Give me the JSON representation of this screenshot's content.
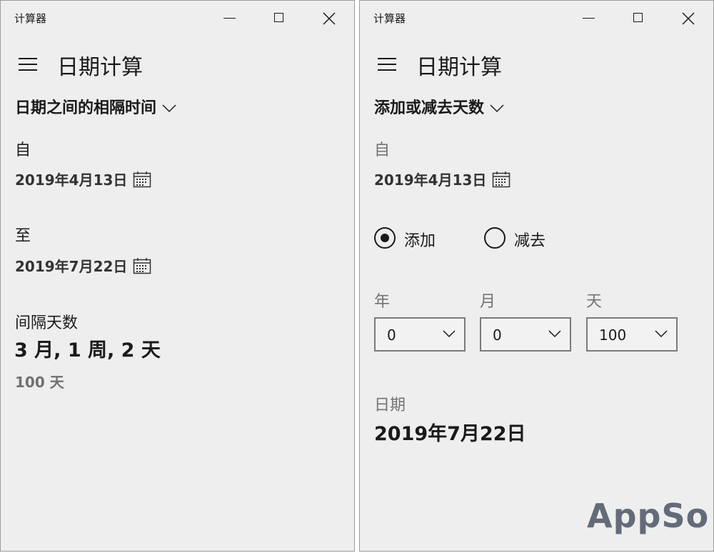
{
  "app_title": "计算器",
  "mode_title": "日期计算",
  "left": {
    "mode": "日期之间的相隔时间",
    "from_label": "自",
    "from_date": "2019年4月13日",
    "to_label": "至",
    "to_date": "2019年7月22日",
    "diff_label": "间隔天数",
    "diff_result": "3 月, 1 周, 2 天",
    "diff_days": "100 天"
  },
  "right": {
    "mode": "添加或减去天数",
    "from_label": "自",
    "from_date": "2019年4月13日",
    "radio_add": "添加",
    "radio_subtract": "减去",
    "selected_operation": "添加",
    "year_label": "年",
    "month_label": "月",
    "day_label": "天",
    "years": "0",
    "months": "0",
    "days": "100",
    "result_label": "日期",
    "result_date": "2019年7月22日"
  },
  "watermark": "AppSo",
  "colors": {
    "window_bg": "#eeeeee",
    "text": "#1a1a1a",
    "muted_text": "#737373",
    "combo_border": "#7a7a7a",
    "watermark": "#646b78"
  },
  "icons": [
    "minimize-icon",
    "maximize-icon",
    "close-icon",
    "hamburger-menu-icon",
    "chevron-down-icon",
    "calendar-icon",
    "radio-selected-icon",
    "radio-unselected-icon"
  ]
}
